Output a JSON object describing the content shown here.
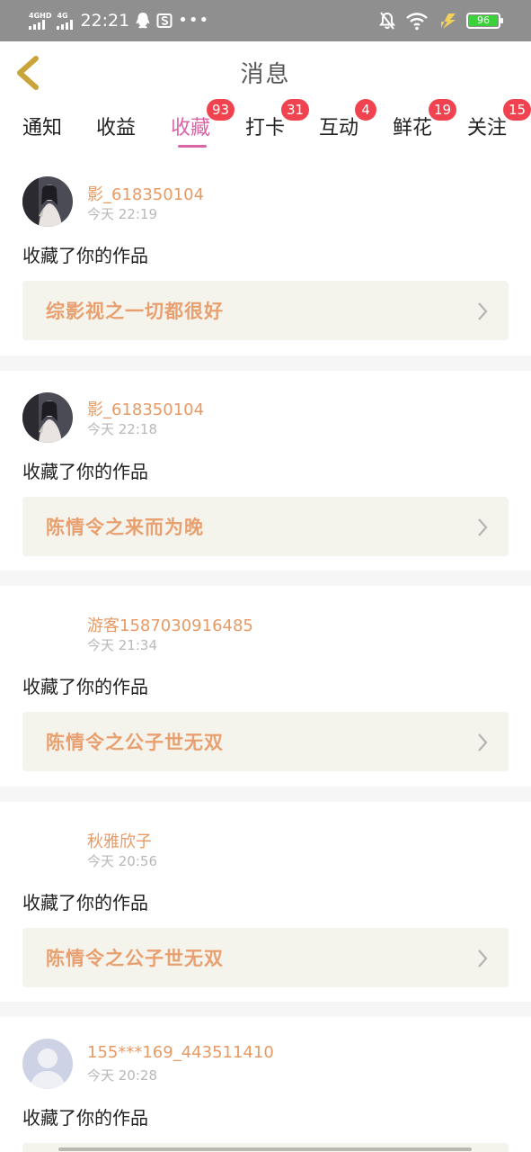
{
  "status_bar": {
    "signal1_label": "4GHD",
    "signal2_label": "4G",
    "time": "22:21",
    "dots": "•••",
    "battery": "96",
    "battery_level_percent": 96
  },
  "header": {
    "title": "消息"
  },
  "tabs": [
    {
      "label": "通知",
      "badge": null,
      "active": false
    },
    {
      "label": "收益",
      "badge": null,
      "active": false
    },
    {
      "label": "收藏",
      "badge": "93",
      "active": true
    },
    {
      "label": "打卡",
      "badge": "31",
      "active": false
    },
    {
      "label": "互动",
      "badge": "4",
      "active": false
    },
    {
      "label": "鲜花",
      "badge": "19",
      "active": false
    },
    {
      "label": "关注",
      "badge": "15",
      "active": false
    }
  ],
  "messages": [
    {
      "user": "影_618350104",
      "time": "今天 22:19",
      "action": "收藏了你的作品",
      "work": "综影视之一切都很好",
      "avatar": "photo"
    },
    {
      "user": "影_618350104",
      "time": "今天 22:18",
      "action": "收藏了你的作品",
      "work": "陈情令之来而为晚",
      "avatar": "photo"
    },
    {
      "user": "游客1587030916485",
      "time": "今天 21:34",
      "action": "收藏了你的作品",
      "work": "陈情令之公子世无双",
      "avatar": "none"
    },
    {
      "user": "秋雅欣子",
      "time": "今天 20:56",
      "action": "收藏了你的作品",
      "work": "陈情令之公子世无双",
      "avatar": "none"
    },
    {
      "user": "155***169_443511410",
      "time": "今天 20:28",
      "action": "收藏了你的作品",
      "work": "",
      "avatar": "default"
    }
  ],
  "colors": {
    "status_bar_bg": "#8f8f8f",
    "accent_tab": "#d965a6",
    "badge": "#f0434f",
    "username": "#e79a64",
    "work_title": "#e8a070",
    "work_card_bg": "#f4f4ec",
    "back_icon": "#c9a43a"
  },
  "icons": {
    "back": "chevron-left-icon",
    "card_arrow": "chevron-right-icon",
    "notification_off": "bell-off-icon",
    "wifi": "wifi-icon",
    "charging": "lightning-icon",
    "qq": "qq-penguin-icon",
    "app": "app-s-icon"
  }
}
